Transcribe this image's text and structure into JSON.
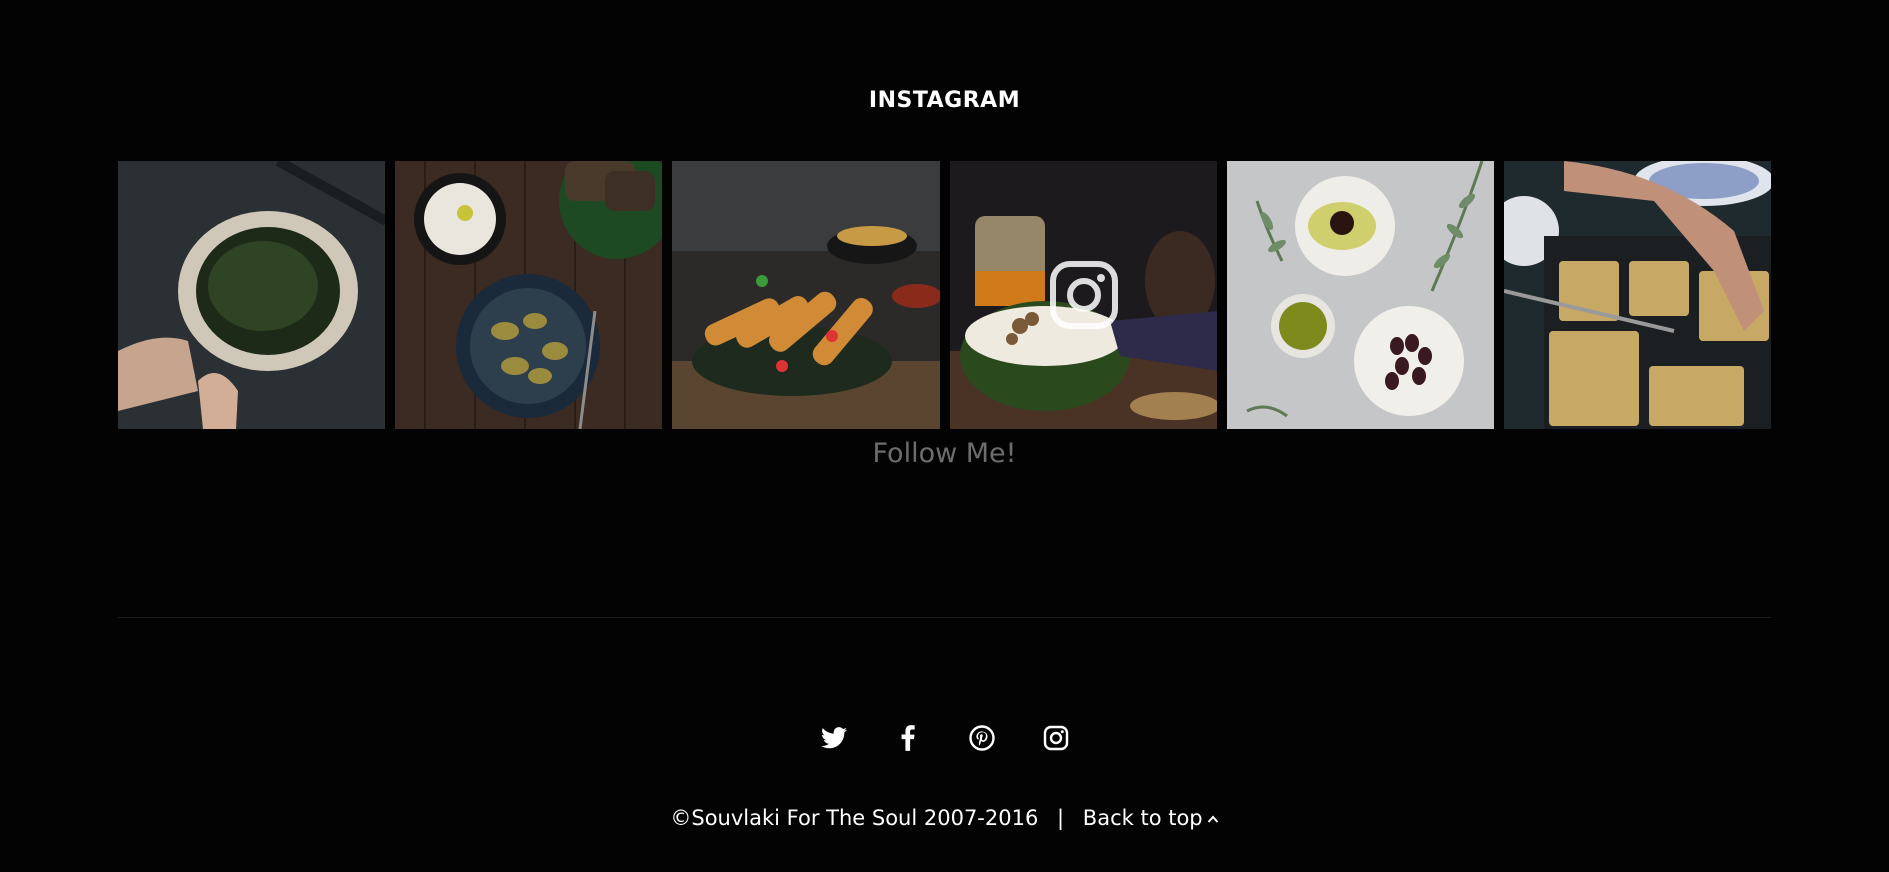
{
  "instagram": {
    "title": "INSTAGRAM",
    "follow_label": "Follow Me!",
    "photos": [
      {
        "subject": "spinach pie in phyllo with hands"
      },
      {
        "subject": "yogurt dip, bread and zucchini plate"
      },
      {
        "subject": "fried cheese rolls with tomatoes"
      },
      {
        "subject": "honey and mashed dip with walnuts"
      },
      {
        "subject": "olive oil, vinegar and olives"
      },
      {
        "subject": "sliced pie in baking tray"
      }
    ]
  },
  "social": {
    "items": [
      "twitter-icon",
      "facebook-icon",
      "pinterest-icon",
      "instagram-icon"
    ]
  },
  "footer": {
    "copyright": "©Souvlaki For The Soul 2007-2016",
    "separator": "|",
    "back_to_top": "Back to top"
  },
  "colors": {
    "background": "#030303",
    "muted_text": "#6d6d6d",
    "text": "#ffffff"
  }
}
